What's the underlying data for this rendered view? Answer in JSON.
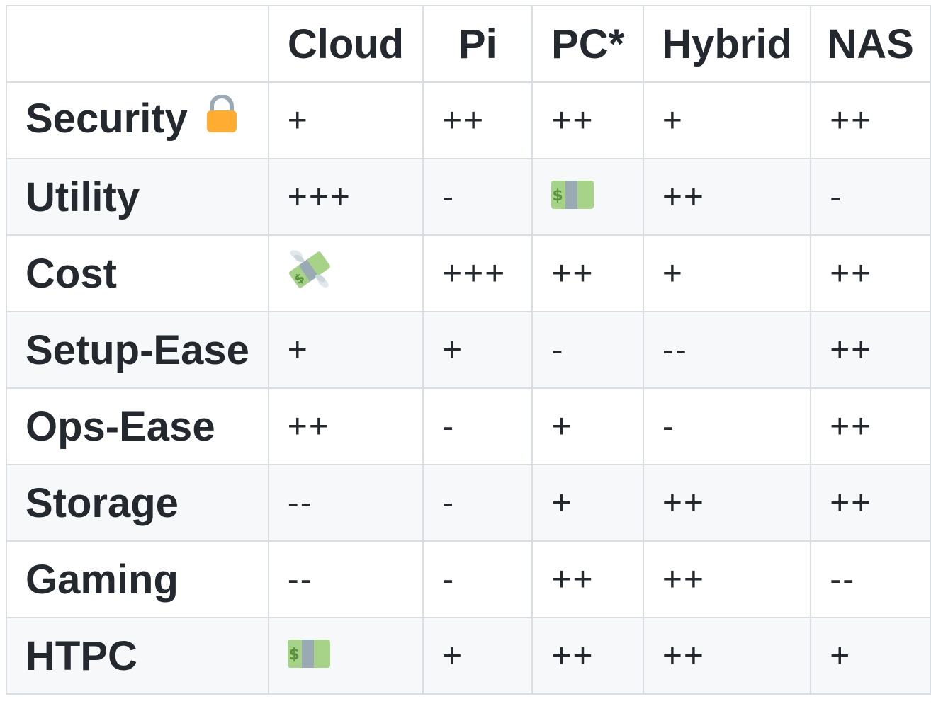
{
  "table": {
    "columns": [
      "",
      "Cloud",
      "Pi",
      "PC*",
      "Hybrid",
      "NAS"
    ],
    "rows": [
      {
        "label": "Security",
        "icon": "lock-icon",
        "cells": [
          "+",
          "++",
          "++",
          "+",
          "++"
        ]
      },
      {
        "label": "Utility",
        "cells": [
          "+++",
          "-",
          "dollar-banknote-icon",
          "++",
          "-"
        ]
      },
      {
        "label": "Cost",
        "cells": [
          "money-with-wings-icon",
          "+++",
          "++",
          "+",
          "++"
        ]
      },
      {
        "label": "Setup-Ease",
        "cells": [
          "+",
          "+",
          "-",
          "--",
          "++"
        ]
      },
      {
        "label": "Ops-Ease",
        "cells": [
          "++",
          "-",
          "+",
          "-",
          "++"
        ]
      },
      {
        "label": "Storage",
        "cells": [
          "--",
          "-",
          "+",
          "++",
          "++"
        ]
      },
      {
        "label": "Gaming",
        "cells": [
          "--",
          "-",
          "++",
          "++",
          "--"
        ]
      },
      {
        "label": "HTPC",
        "cells": [
          "dollar-banknote-icon",
          "+",
          "++",
          "++",
          "+"
        ]
      }
    ]
  },
  "colors": {
    "text": "#24292f",
    "border": "#d8dee4",
    "row_alt": "#f6f8fa",
    "lock_body": "#ffac33",
    "lock_shackle": "#99aab5",
    "banknote": "#a6d388",
    "banknote_band": "#99aab5",
    "banknote_symbol": "#5c913b"
  }
}
